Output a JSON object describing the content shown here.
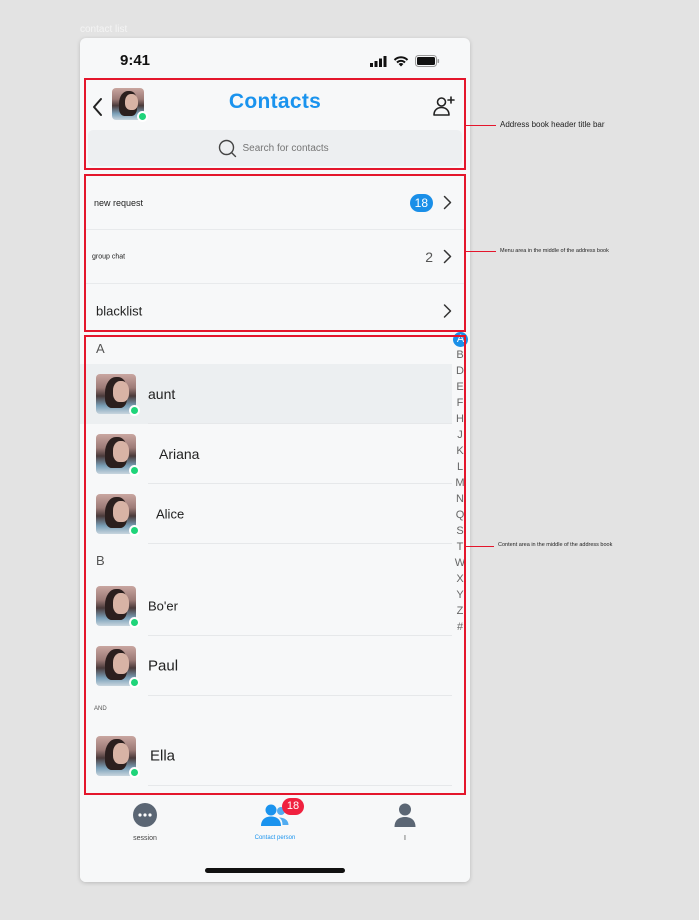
{
  "artboard_label": "contact list",
  "status_bar": {
    "time": "9:41"
  },
  "header": {
    "title": "Contacts",
    "search_placeholder": "Search for contacts"
  },
  "menu": {
    "items": [
      {
        "label": "new request",
        "badge": "18"
      },
      {
        "label": "group chat",
        "count": "2"
      },
      {
        "label": "blacklist"
      }
    ]
  },
  "contacts": {
    "sections": [
      {
        "letter": "A",
        "contacts": [
          {
            "name": "aunt"
          },
          {
            "name": "Ariana"
          },
          {
            "name": "Alice"
          }
        ]
      },
      {
        "letter": "B",
        "contacts": [
          {
            "name": "Bo'er"
          },
          {
            "name": "Paul"
          }
        ]
      },
      {
        "letter": "AND",
        "contacts": [
          {
            "name": "Ella"
          }
        ]
      }
    ]
  },
  "alphabet_index": [
    "A",
    "B",
    "D",
    "E",
    "F",
    "H",
    "J",
    "K",
    "L",
    "M",
    "N",
    "Q",
    "S",
    "T",
    "W",
    "X",
    "Y",
    "Z",
    "#"
  ],
  "alphabet_active": "A",
  "tab_bar": {
    "tabs": [
      {
        "label": "session",
        "icon": "chat-bubble-icon"
      },
      {
        "label": "Contact person",
        "icon": "contacts-icon",
        "badge": "18"
      },
      {
        "label": "I",
        "icon": "person-icon"
      }
    ]
  },
  "annotations": [
    {
      "label": "Address book header title bar"
    },
    {
      "label": "Menu area in the middle of the address book"
    },
    {
      "label": "Content area in the middle of the address book"
    }
  ],
  "colors": {
    "accent": "#1a93ee",
    "badge_red": "#f0213f",
    "online": "#1fd47a",
    "annotation": "#e4162c"
  }
}
